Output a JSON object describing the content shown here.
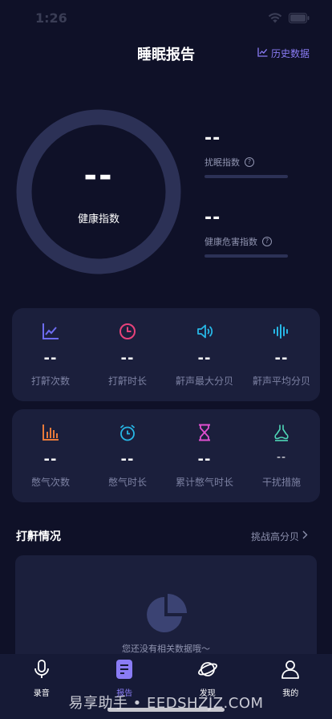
{
  "status": {
    "time": "1:26"
  },
  "header": {
    "title": "睡眠报告",
    "history": "历史数据"
  },
  "ring": {
    "value": "--",
    "label": "健康指数"
  },
  "metrics": [
    {
      "value": "--",
      "label": "扰眠指数"
    },
    {
      "value": "--",
      "label": "健康危害指数"
    }
  ],
  "snore_card": [
    {
      "icon": "line-chart-icon",
      "value": "--",
      "label": "打鼾次数",
      "color": "#6d6cf0"
    },
    {
      "icon": "clock-icon",
      "value": "--",
      "label": "打鼾时长",
      "color": "#e8427a"
    },
    {
      "icon": "speaker-icon",
      "value": "--",
      "label": "鼾声最大分贝",
      "color": "#27b7e6"
    },
    {
      "icon": "sound-wave-icon",
      "value": "--",
      "label": "鼾声平均分贝",
      "color": "#27b7e6"
    }
  ],
  "apnea_card": [
    {
      "icon": "bar-chart-icon",
      "value": "--",
      "label": "憋气次数",
      "color": "#e97a3a"
    },
    {
      "icon": "alarm-clock-icon",
      "value": "--",
      "label": "憋气时长",
      "color": "#27b7e6"
    },
    {
      "icon": "hourglass-icon",
      "value": "--",
      "label": "累计憋气时长",
      "color": "#e04fd0"
    },
    {
      "icon": "nose-icon",
      "value": "--",
      "label": "干扰措施",
      "color": "#4fd8b8"
    }
  ],
  "section": {
    "title": "打鼾情况",
    "link": "挑战高分贝"
  },
  "empty": {
    "text": "您还没有相关数据哦～"
  },
  "tabs": [
    {
      "icon": "microphone-icon",
      "label": "录音"
    },
    {
      "icon": "report-icon",
      "label": "报告"
    },
    {
      "icon": "planet-icon",
      "label": "发现"
    },
    {
      "icon": "user-icon",
      "label": "我的"
    }
  ],
  "watermark": "易享助手 • EEDSHZJZ.COM",
  "colors": {
    "background": "#0f1128",
    "card": "#1b1f3c",
    "accent": "#8a7cf5",
    "ring": "#2c3156"
  }
}
